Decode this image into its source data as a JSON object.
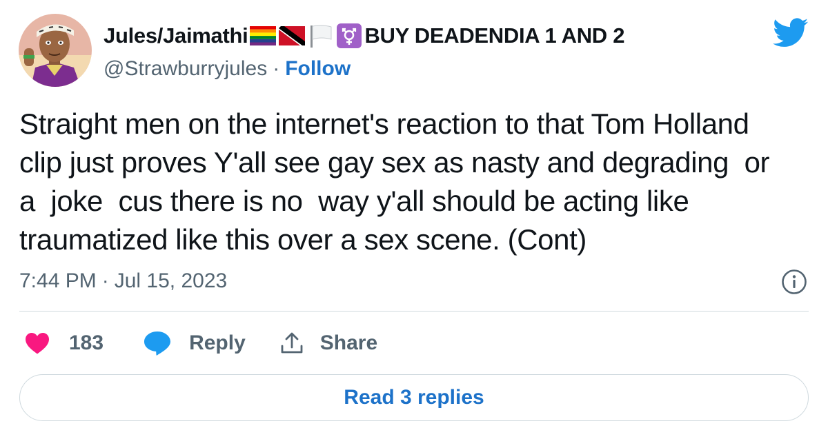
{
  "author": {
    "display_name": "Jules/Jaimathi",
    "name_suffix": "BUY DEADENDIA 1 AND 2",
    "name_emojis": [
      "rainbow-flag-icon",
      "trinidad-flag-icon",
      "white-flag-icon",
      "transgender-symbol-icon"
    ],
    "handle": "@Strawburryjules",
    "separator": "·",
    "follow_label": "Follow",
    "avatar": "cartoon-avatar"
  },
  "tweet": {
    "text": "Straight men on the internet's reaction to that Tom Holland\nclip just proves Y'all see gay sex as nasty and degrading  or\na  joke  cus there is no  way y'all should be acting like\ntraumatized like this over a sex scene. (Cont)",
    "time": "7:44 PM",
    "date": "Jul 15, 2023",
    "meta_separator": "·"
  },
  "actions": {
    "like_count": "183",
    "reply_label": "Reply",
    "share_label": "Share"
  },
  "read_replies_label": "Read 3 replies",
  "colors": {
    "accent": "#1d72c9",
    "twitter_blue": "#1d9bf0",
    "heart": "#f91880",
    "secondary_text": "#536471",
    "divider": "#cfd9de"
  },
  "icons": {
    "brand": "twitter-bird-icon",
    "info": "info-icon",
    "like": "heart-icon",
    "reply": "reply-bubble-icon",
    "share": "share-icon"
  }
}
